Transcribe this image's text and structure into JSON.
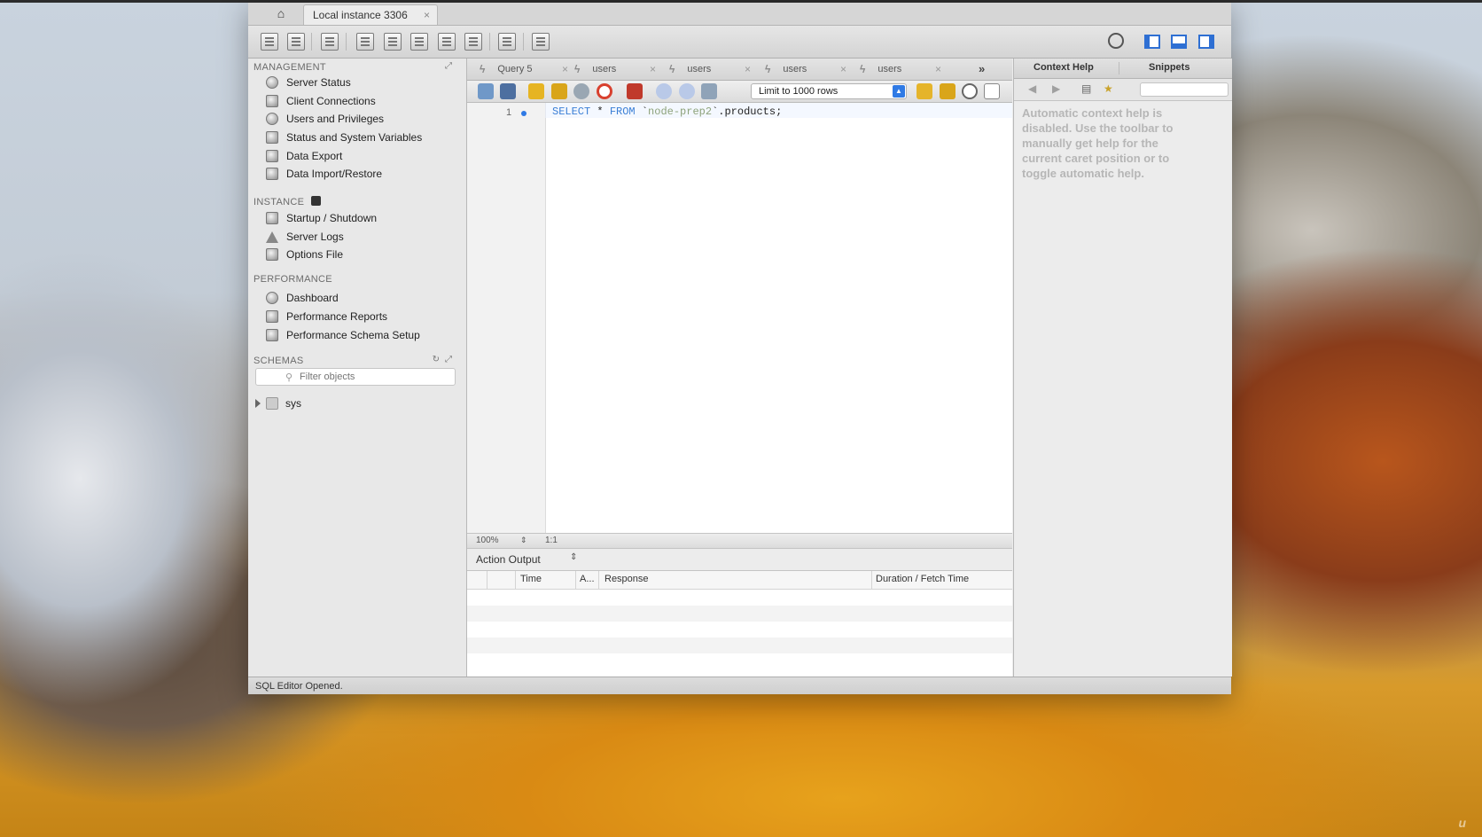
{
  "window": {
    "connection_tab": "Local instance 3306",
    "status_bar": "SQL Editor Opened."
  },
  "sidebar": {
    "management_title": "MANAGEMENT",
    "management_items": [
      "Server Status",
      "Client Connections",
      "Users and Privileges",
      "Status and System Variables",
      "Data Export",
      "Data Import/Restore"
    ],
    "instance_title": "INSTANCE",
    "instance_items": [
      "Startup / Shutdown",
      "Server Logs",
      "Options File"
    ],
    "performance_title": "PERFORMANCE",
    "performance_items": [
      "Dashboard",
      "Performance Reports",
      "Performance Schema Setup"
    ],
    "schemas_title": "SCHEMAS",
    "filter_placeholder": "Filter objects",
    "schemas": [
      "sys"
    ]
  },
  "editor": {
    "query_tabs": [
      "Query 5",
      "users",
      "users",
      "users",
      "users"
    ],
    "more_tabs": "»",
    "limit_select": "Limit to 1000 rows",
    "line_number": "1",
    "code": {
      "kw1": "SELECT",
      "mid1": " * ",
      "kw2": "FROM",
      "mid2": " `",
      "schema": "node-prep2",
      "tail": "`.products;"
    },
    "zoom": "100%",
    "position": "1:1"
  },
  "output": {
    "header": "Action Output",
    "columns": [
      "Time",
      "A...",
      "Response",
      "Duration / Fetch Time"
    ]
  },
  "right_panel": {
    "tabs": [
      "Context Help",
      "Snippets"
    ],
    "help_text": "Automatic context help is disabled. Use the toolbar to manually get help for the current caret position or to toggle automatic help."
  },
  "watermark": "u"
}
